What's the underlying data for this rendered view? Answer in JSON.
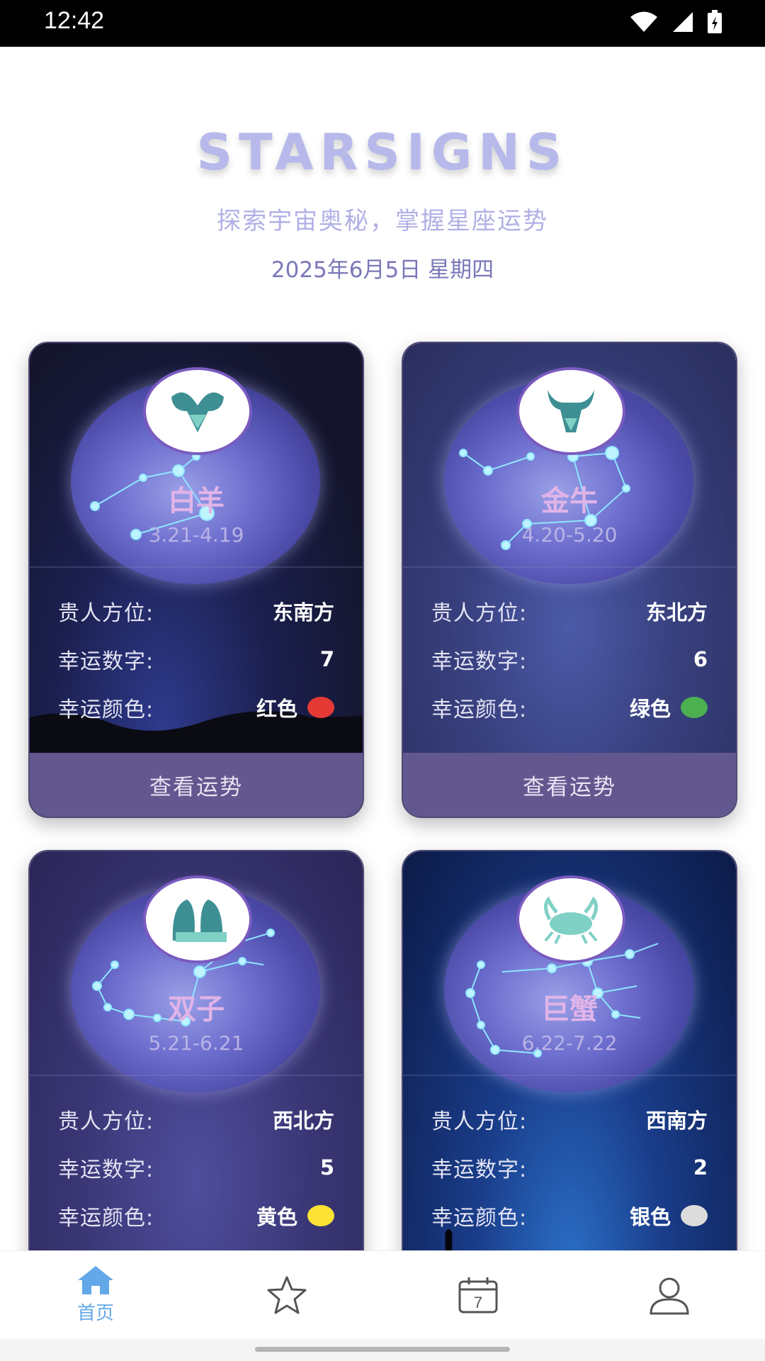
{
  "status_bar": {
    "time": "12:42"
  },
  "header": {
    "brand": "STARSIGNS",
    "tagline": "探索宇宙奥秘，掌握星座运势",
    "date": "2025年6月5日 星期四"
  },
  "labels": {
    "benefactor": "贵人方位:",
    "lucky_number": "幸运数字:",
    "lucky_color": "幸运颜色:",
    "view_button": "查看运势"
  },
  "cards": [
    {
      "name": "白羊",
      "range": "3.21-4.19",
      "direction": "东南方",
      "number": "7",
      "color_name": "红色",
      "color_hex": "#e53935",
      "emblem": "aries-icon"
    },
    {
      "name": "金牛",
      "range": "4.20-5.20",
      "direction": "东北方",
      "number": "6",
      "color_name": "绿色",
      "color_hex": "#4caf50",
      "emblem": "taurus-icon"
    },
    {
      "name": "双子",
      "range": "5.21-6.21",
      "direction": "西北方",
      "number": "5",
      "color_name": "黄色",
      "color_hex": "#fde235",
      "emblem": "gemini-icon"
    },
    {
      "name": "巨蟹",
      "range": "6.22-7.22",
      "direction": "西南方",
      "number": "2",
      "color_name": "银色",
      "color_hex": "#dcdcdc",
      "emblem": "cancer-icon"
    }
  ],
  "nav": {
    "items": [
      {
        "label": "首页",
        "icon": "home-icon",
        "active": true
      },
      {
        "label": "",
        "icon": "star-icon"
      },
      {
        "label": "",
        "icon": "calendar-icon"
      },
      {
        "label": "",
        "icon": "profile-icon"
      }
    ],
    "calendar_day": "7",
    "active_color": "#63a8e8"
  }
}
